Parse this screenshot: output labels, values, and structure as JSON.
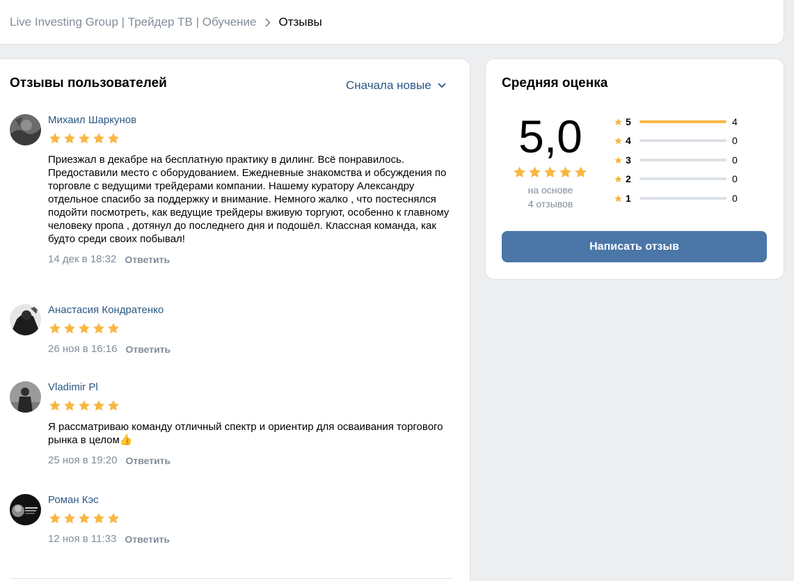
{
  "breadcrumb": {
    "parent": "Live Investing Group | Трейдер ТВ | Обучение",
    "current": "Отзывы"
  },
  "reviews_panel": {
    "title": "Отзывы пользователей",
    "sort_label": "Сначала новые",
    "reply_label": "Ответить",
    "items": [
      {
        "author": "Михаил Шаркунов",
        "stars": 5,
        "text": "Приезжал в декабре на бесплатную практику в дилинг. Всё понравилось. Предоставили место с оборудованием. Ежедневные знакомства и обсуждения по торговле с ведущими трейдерами компании. Нашему куратору Александру отдельное спасибо за поддержку и внимание. Немного жалко , что постеснялся подойти посмотреть, как ведущие трейдеры вживую торгуют, особенно к главному человеку пропа , дотянул до последнего дня и подошёл. Классная команда, как будто среди своих побывал!",
        "date": "14 дек в 18:32"
      },
      {
        "author": "Анастасия Кондратенко",
        "stars": 5,
        "text": "",
        "date": "26 ноя в 16:16"
      },
      {
        "author": "Vladimir Pl",
        "stars": 5,
        "text": "Я рассматриваю команду отличный спектр и ориентир для осваивания торгового рынка в целом👍",
        "date": "25 ноя в 19:20"
      },
      {
        "author": "Роман Кэс",
        "stars": 5,
        "text": "",
        "date": "12 ноя в 11:33"
      }
    ]
  },
  "rating_panel": {
    "title": "Средняя оценка",
    "average": "5,0",
    "average_stars": 5,
    "basis_line1": "на основе",
    "basis_line2": "4 отзывов",
    "distribution": [
      {
        "stars": "5",
        "count": "4",
        "fraction": 1.0
      },
      {
        "stars": "4",
        "count": "0",
        "fraction": 0
      },
      {
        "stars": "3",
        "count": "0",
        "fraction": 0
      },
      {
        "stars": "2",
        "count": "0",
        "fraction": 0
      },
      {
        "stars": "1",
        "count": "0",
        "fraction": 0
      }
    ],
    "write_button": "Написать отзыв"
  },
  "colors": {
    "star": "#f8b744",
    "link": "#2a5885",
    "button": "#4a76a8",
    "muted": "#818c99",
    "bar_bg": "#dce1e6"
  },
  "icons": [
    "star-icon",
    "chevron-right-icon",
    "chevron-down-icon"
  ]
}
